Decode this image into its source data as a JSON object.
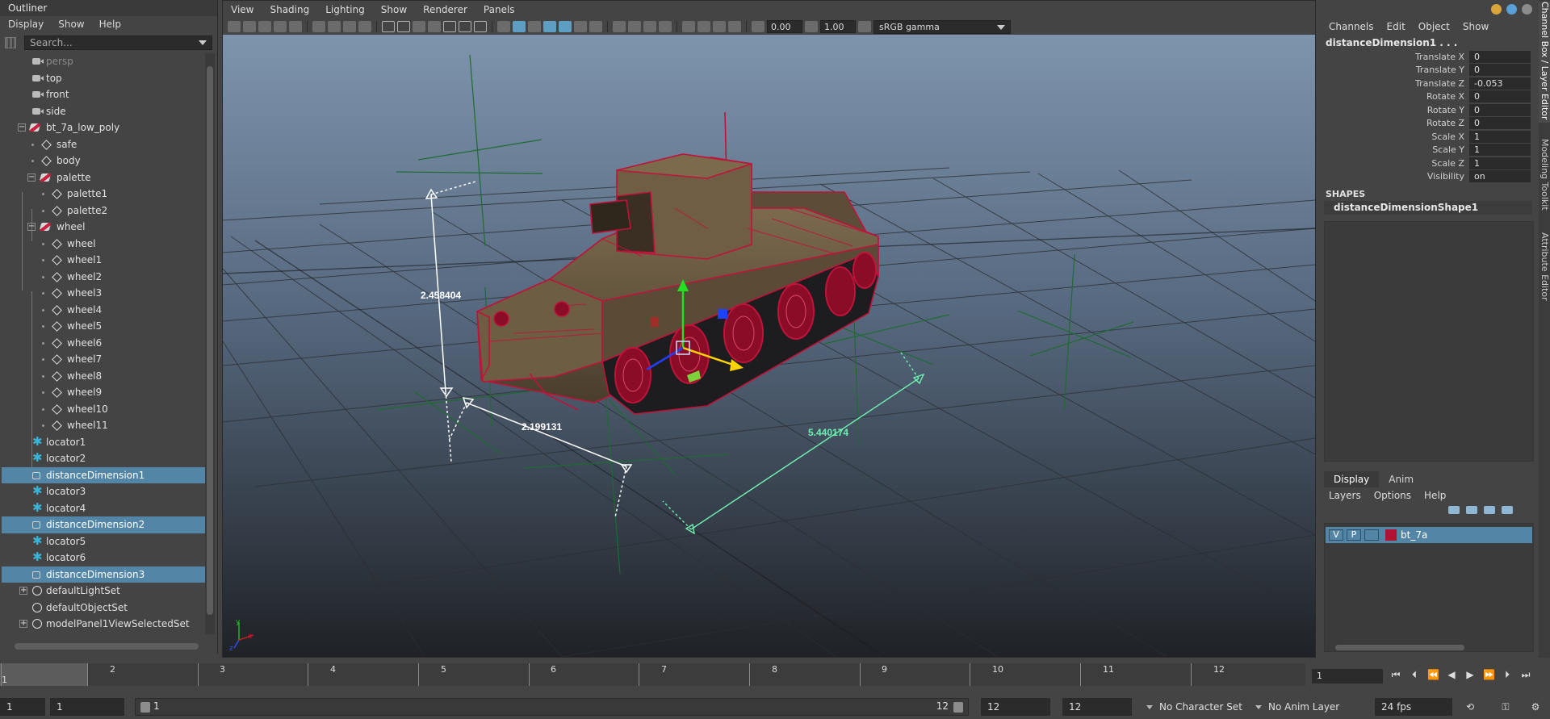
{
  "outliner": {
    "title": "Outliner",
    "menu": [
      "Display",
      "Show",
      "Help"
    ],
    "search_placeholder": "Search...",
    "items": [
      {
        "label": "persp"
      },
      {
        "label": "top"
      },
      {
        "label": "front"
      },
      {
        "label": "side"
      },
      {
        "label": "bt_7a_low_poly"
      },
      {
        "label": "safe"
      },
      {
        "label": "body"
      },
      {
        "label": "palette"
      },
      {
        "label": "palette1"
      },
      {
        "label": "palette2"
      },
      {
        "label": "wheel"
      },
      {
        "label": "wheel"
      },
      {
        "label": "wheel1"
      },
      {
        "label": "wheel2"
      },
      {
        "label": "wheel3"
      },
      {
        "label": "wheel4"
      },
      {
        "label": "wheel5"
      },
      {
        "label": "wheel6"
      },
      {
        "label": "wheel7"
      },
      {
        "label": "wheel8"
      },
      {
        "label": "wheel9"
      },
      {
        "label": "wheel10"
      },
      {
        "label": "wheel11"
      },
      {
        "label": "locator1"
      },
      {
        "label": "locator2"
      },
      {
        "label": "distanceDimension1"
      },
      {
        "label": "locator3"
      },
      {
        "label": "locator4"
      },
      {
        "label": "distanceDimension2"
      },
      {
        "label": "locator5"
      },
      {
        "label": "locator6"
      },
      {
        "label": "distanceDimension3"
      },
      {
        "label": "defaultLightSet"
      },
      {
        "label": "defaultObjectSet"
      },
      {
        "label": "modelPanel1ViewSelectedSet"
      }
    ]
  },
  "viewport": {
    "menu": [
      "View",
      "Shading",
      "Lighting",
      "Show",
      "Renderer",
      "Panels"
    ],
    "exposure": "0.00",
    "gamma_value": "1.00",
    "color_space": "sRGB gamma",
    "measurements": [
      "2.458404",
      "2.199131",
      "5.440174"
    ],
    "axis_labels": {
      "x": "x",
      "y": "y",
      "z": "z"
    },
    "colors": {
      "mesh_wire": "#c0133a",
      "locator": "#1e6b32",
      "measure_white": "#ffffff",
      "measure_green": "#6ff0b0"
    }
  },
  "channel_box": {
    "menu": [
      "Channels",
      "Edit",
      "Object",
      "Show"
    ],
    "object_name": "distanceDimension1 . . .",
    "channels": [
      {
        "name": "Translate X",
        "value": "0"
      },
      {
        "name": "Translate Y",
        "value": "0"
      },
      {
        "name": "Translate Z",
        "value": "-0.053"
      },
      {
        "name": "Rotate X",
        "value": "0"
      },
      {
        "name": "Rotate Y",
        "value": "0"
      },
      {
        "name": "Rotate Z",
        "value": "0"
      },
      {
        "name": "Scale X",
        "value": "1"
      },
      {
        "name": "Scale Y",
        "value": "1"
      },
      {
        "name": "Scale Z",
        "value": "1"
      },
      {
        "name": "Visibility",
        "value": "on"
      }
    ],
    "shapes_header": "SHAPES",
    "shape_name": "distanceDimensionShape1",
    "layer_tabs": [
      "Display",
      "Anim"
    ],
    "layer_menu": [
      "Layers",
      "Options",
      "Help"
    ],
    "layer": {
      "v": "V",
      "p": "P",
      "name": "bt_7a",
      "color": "#b01232"
    },
    "side_tabs": [
      "Channel Box / Layer Editor",
      "Modeling Toolkit",
      "Attribute Editor"
    ]
  },
  "timeline": {
    "ticks": [
      "1",
      "2",
      "3",
      "4",
      "5",
      "6",
      "7",
      "8",
      "9",
      "10",
      "11",
      "12"
    ],
    "current_frame": "1"
  },
  "range": {
    "anim_start": "1",
    "range_start": "1",
    "slider_start": "1",
    "slider_end": "12",
    "range_end": "12",
    "anim_end": "12",
    "character_set": "No Character Set",
    "anim_layer": "No Anim Layer",
    "fps": "24 fps"
  }
}
